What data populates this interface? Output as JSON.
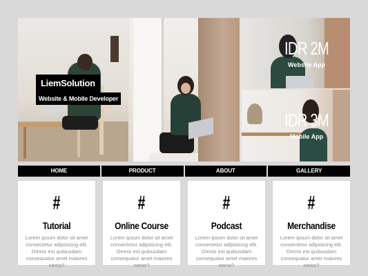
{
  "brand": {
    "name": "LiemSolution",
    "tagline": "Website & Mobile Developer"
  },
  "prices": [
    {
      "amount": "IDR 2M",
      "label": "Website App"
    },
    {
      "amount": "IDR 3M",
      "label": "Mobile App"
    }
  ],
  "nav": {
    "items": [
      {
        "label": "HOME"
      },
      {
        "label": "PRODUCT"
      },
      {
        "label": "ABOUT"
      },
      {
        "label": "GALLERY"
      }
    ]
  },
  "cards": [
    {
      "icon": "#",
      "title": "Tutorial",
      "text": "Lorem ipsum dolor sit amet consectetur adipisicing elit. Omnis est quibusdam consequatur amet maiores nemo?"
    },
    {
      "icon": "#",
      "title": "Online Course",
      "text": "Lorem ipsum dolor sit amet consectetur adipisicing elit. Omnis est quibusdam consequatur amet maiores nemo?"
    },
    {
      "icon": "#",
      "title": "Podcast",
      "text": "Lorem ipsum dolor sit amet consectetur adipisicing elit. Omnis est quibusdam consequatur amet maiores nemo?"
    },
    {
      "icon": "#",
      "title": "Merchandise",
      "text": "Lorem ipsum dolor sit amet consectetur adipisicing elit. Omnis est quibusdam consequatur amet maiores nemo?"
    }
  ],
  "colors": {
    "background": "#d9d9d9",
    "nav": "#000000",
    "card": "#ffffff",
    "muted_text": "#8a8a8a"
  }
}
